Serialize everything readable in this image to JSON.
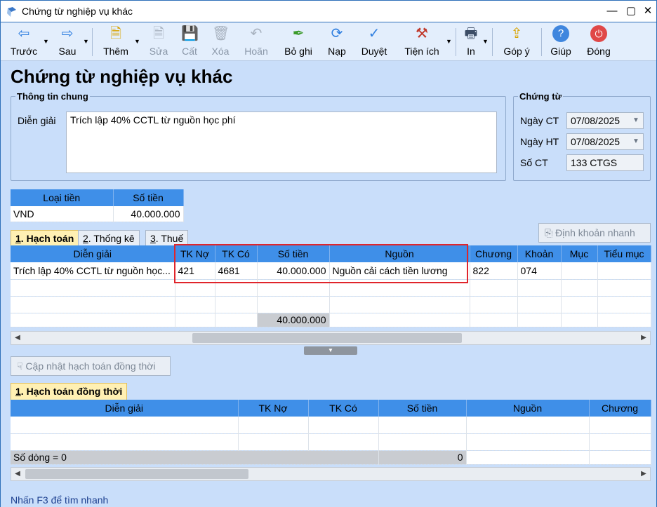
{
  "window": {
    "title": "Chứng từ nghiệp vụ khác"
  },
  "toolbar": {
    "items": [
      {
        "label": "Trước",
        "icon": "arrow-left-icon",
        "enabled": true
      },
      {
        "label": "Sau",
        "icon": "arrow-right-icon",
        "enabled": true
      },
      {
        "label": "Thêm",
        "icon": "new-document-icon",
        "enabled": true
      },
      {
        "label": "Sửa",
        "icon": "edit-document-icon",
        "enabled": false
      },
      {
        "label": "Cất",
        "icon": "save-icon",
        "enabled": false
      },
      {
        "label": "Xóa",
        "icon": "delete-document-icon",
        "enabled": false
      },
      {
        "label": "Hoãn",
        "icon": "undo-icon",
        "enabled": false
      },
      {
        "label": "Bỏ ghi",
        "icon": "unpost-pen-icon",
        "enabled": true
      },
      {
        "label": "Nạp",
        "icon": "refresh-icon",
        "enabled": true
      },
      {
        "label": "Duyệt",
        "icon": "checkmark-icon",
        "enabled": true
      },
      {
        "label": "Tiện ích",
        "icon": "tools-icon",
        "enabled": true
      },
      {
        "label": "In",
        "icon": "printer-icon",
        "enabled": true
      },
      {
        "label": "Góp ý",
        "icon": "feedback-icon",
        "enabled": true
      },
      {
        "label": "Giúp",
        "icon": "help-icon",
        "enabled": true
      },
      {
        "label": "Đóng",
        "icon": "power-icon",
        "enabled": true
      }
    ]
  },
  "page": {
    "title": "Chứng từ nghiệp vụ khác"
  },
  "general": {
    "legend": "Thông tin chung",
    "description_label": "Diễn giải",
    "description_value": "Trích lập 40% CCTL từ nguồn học phí"
  },
  "voucher": {
    "legend": "Chứng từ",
    "date_ct_label": "Ngày CT",
    "date_ct_value": "07/08/2025",
    "date_ht_label": "Ngày HT",
    "date_ht_value": "07/08/2025",
    "number_label": "Số CT",
    "number_value": "133 CTGS"
  },
  "currency": {
    "headers": [
      "Loại tiền",
      "Số tiền"
    ],
    "currency_value": "VND",
    "amount_value": "40.000.000"
  },
  "tabs": [
    {
      "key": "1",
      "label": ". Hạch toán"
    },
    {
      "key": "2",
      "label": ". Thống kê"
    },
    {
      "key": "3",
      "label": ". Thuế"
    }
  ],
  "quick_entry_button": "Định khoản nhanh",
  "entries": {
    "headers": [
      "Diễn giải",
      "TK Nợ",
      "TK Có",
      "Số tiền",
      "Nguồn",
      "Chương",
      "Khoản",
      "Mục",
      "Tiểu mục"
    ],
    "row": {
      "description": "Trích lập 40% CCTL từ nguồn học...",
      "debit": "421",
      "credit": "4681",
      "amount": "40.000.000",
      "source": "Nguồn cải cách tiền lương",
      "chapter": "822",
      "item": "074",
      "sub": "",
      "subitem": ""
    },
    "total_amount": "40.000.000"
  },
  "update_button": "Cập nhật hạch toán đồng thời",
  "concurrent": {
    "tab_key": "1",
    "tab_label": ". Hạch toán đồng thời",
    "headers": [
      "Diễn giải",
      "TK Nợ",
      "TK Có",
      "Số tiền",
      "Nguồn",
      "Chương"
    ],
    "row_count_label": "Số dòng = 0",
    "total_amount": "0"
  },
  "status": {
    "hint": "Nhấn F3 để tìm nhanh"
  }
}
